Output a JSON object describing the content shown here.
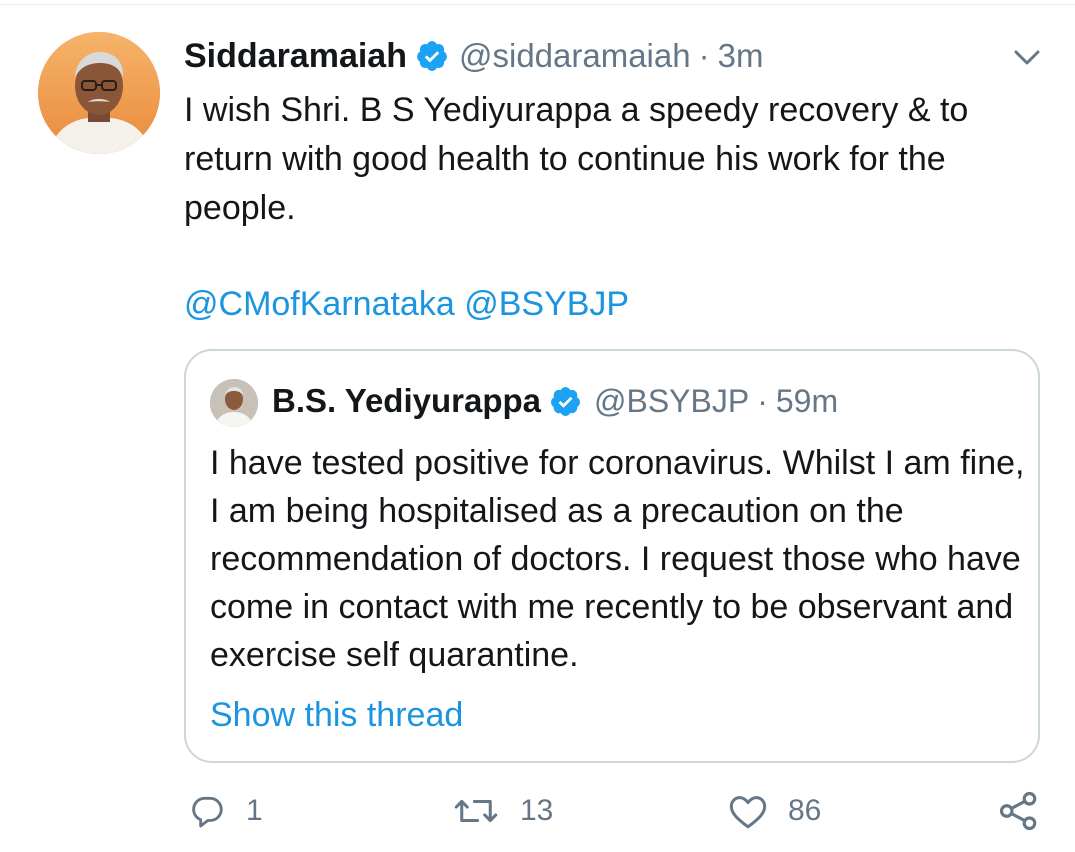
{
  "tweet": {
    "display_name": "Siddaramaiah",
    "verified_icon": "verified-badge-icon",
    "handle": "@siddaramaiah",
    "separator": "·",
    "time": "3m",
    "text": "I wish Shri. B S Yediyurappa a speedy recovery & to return with good health to continue his work for the people.",
    "mentions": [
      "@CMofKarnataka",
      "@BSYBJP"
    ]
  },
  "quoted_tweet": {
    "display_name": "B.S. Yediyurappa",
    "handle": "@BSYBJP",
    "separator": "·",
    "time": "59m",
    "text": "I have tested positive for coronavirus. Whilst I am fine, I am being hospitalised as a precaution on the recommendation of doctors. I request those who have come in contact with me recently to be observant and exercise self quarantine.",
    "show_thread_label": "Show this thread"
  },
  "actions": {
    "reply_count": "1",
    "retweet_count": "13",
    "like_count": "86",
    "icons": [
      "reply-icon",
      "retweet-icon",
      "like-icon",
      "share-icon"
    ]
  },
  "colors": {
    "link": "#1b95e0",
    "secondary_text": "#657786",
    "verified": "#1da1f2",
    "border": "#ccd6dd"
  }
}
